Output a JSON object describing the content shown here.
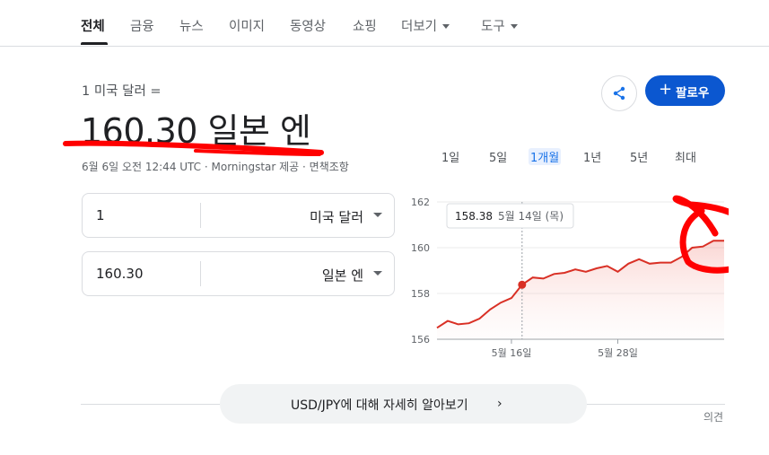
{
  "nav": {
    "tabs": [
      {
        "label": "전체",
        "active": true
      },
      {
        "label": "금융"
      },
      {
        "label": "뉴스"
      },
      {
        "label": "이미지"
      },
      {
        "label": "동영상"
      },
      {
        "label": "쇼핑"
      },
      {
        "label": "더보기",
        "dropdown": true
      },
      {
        "label": "도구",
        "dropdown": true
      }
    ]
  },
  "header": {
    "from_label": "1 미국 달러 =",
    "result": "160.30 일본 엔",
    "meta": "6월 6일 오전 12:44 UTC · Morningstar 제공 · 면책조항",
    "follow_label": "팔로우",
    "follow_plus": "+",
    "share_icon": "share-icon"
  },
  "converter": {
    "from": {
      "value": "1",
      "unit": "미국 달러"
    },
    "to": {
      "value": "160.30",
      "unit": "일본 엔"
    }
  },
  "ranges": [
    {
      "label": "1일"
    },
    {
      "label": "5일"
    },
    {
      "label": "1개월",
      "active": true
    },
    {
      "label": "1년"
    },
    {
      "label": "5년"
    },
    {
      "label": "최대"
    }
  ],
  "chart_data": {
    "type": "area",
    "ylim": [
      156,
      162
    ],
    "yticks": [
      "162",
      "160",
      "158",
      "156"
    ],
    "xtick_labels": [
      {
        "label": "5월 16일",
        "index": 7
      },
      {
        "label": "5월 28일",
        "index": 17
      }
    ],
    "values": [
      156.5,
      156.8,
      156.65,
      156.7,
      156.9,
      157.3,
      157.6,
      157.8,
      158.38,
      158.7,
      158.65,
      158.85,
      158.9,
      159.05,
      158.95,
      159.1,
      159.2,
      158.95,
      159.3,
      159.5,
      159.3,
      159.35,
      159.35,
      159.6,
      160.0,
      160.05,
      160.3,
      160.3
    ],
    "tooltip": {
      "value": "158.38",
      "date": "5월 14일 (목)",
      "index": 8
    },
    "line_color": "#d93025",
    "fill_color": "#fce8e6"
  },
  "learn_more": {
    "label": "USD/JPY에 대해 자세히 알아보기",
    "chevron": "›"
  },
  "feedback": "의견",
  "annotations": {
    "color": "#ff0000"
  }
}
